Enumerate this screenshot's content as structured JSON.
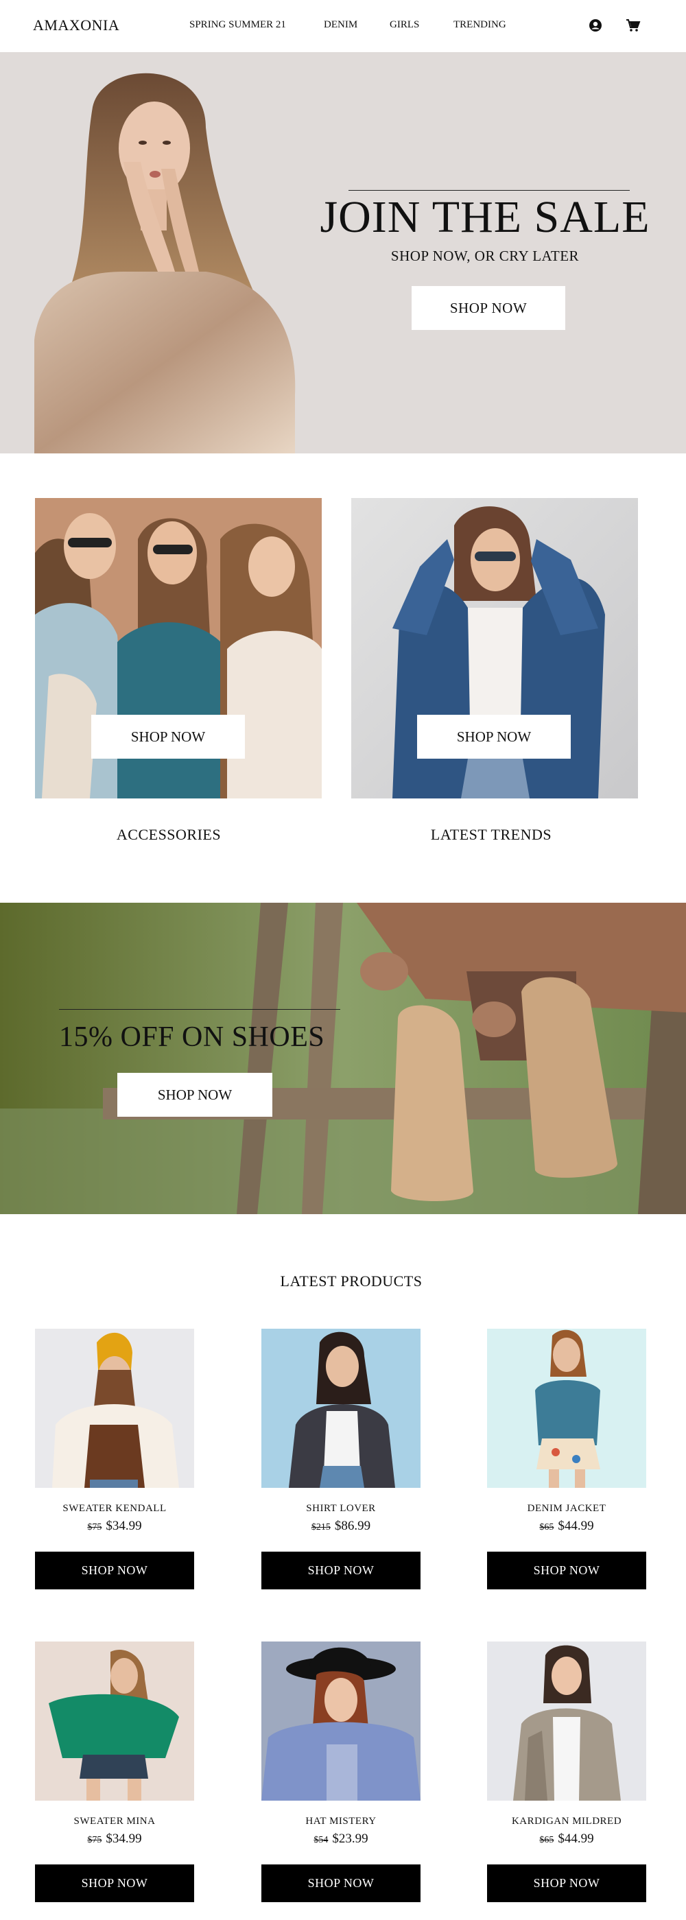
{
  "header": {
    "brand": "AMAXONIA",
    "nav": [
      "SPRING SUMMER 21",
      "DENIM",
      "GIRLS",
      "TRENDING"
    ],
    "icons": [
      "user-account-icon",
      "shopping-cart-icon"
    ]
  },
  "hero": {
    "title": "JOIN THE SALE",
    "subtitle": "SHOP NOW, OR CRY LATER",
    "button": "SHOP NOW",
    "background": "#e0dbd9"
  },
  "categories": [
    {
      "label": "ACCESSORIES",
      "button": "SHOP NOW"
    },
    {
      "label": "LATEST TRENDS",
      "button": "SHOP NOW"
    }
  ],
  "shoes_banner": {
    "title": "15% OFF ON SHOES",
    "button": "SHOP NOW"
  },
  "latest_products": {
    "title": "LATEST PRODUCTS",
    "items": [
      {
        "name": "SWEATER KENDALL",
        "old_price": "$75",
        "price": "$34.99",
        "button": "SHOP NOW"
      },
      {
        "name": "SHIRT LOVER",
        "old_price": "$215",
        "price": "$86.99",
        "button": "SHOP NOW"
      },
      {
        "name": "DENIM JACKET",
        "old_price": "$65",
        "price": "$44.99",
        "button": "SHOP NOW"
      },
      {
        "name": "SWEATER MINA",
        "old_price": "$75",
        "price": "$34.99",
        "button": "SHOP NOW"
      },
      {
        "name": "HAT MISTERY",
        "old_price": "$54",
        "price": "$23.99",
        "button": "SHOP NOW"
      },
      {
        "name": "KARDIGAN MILDRED",
        "old_price": "$65",
        "price": "$44.99",
        "button": "SHOP NOW"
      }
    ]
  },
  "colors": {
    "text": "#111111",
    "button_dark": "#000000",
    "hero_bg": "#e0dbd9"
  }
}
